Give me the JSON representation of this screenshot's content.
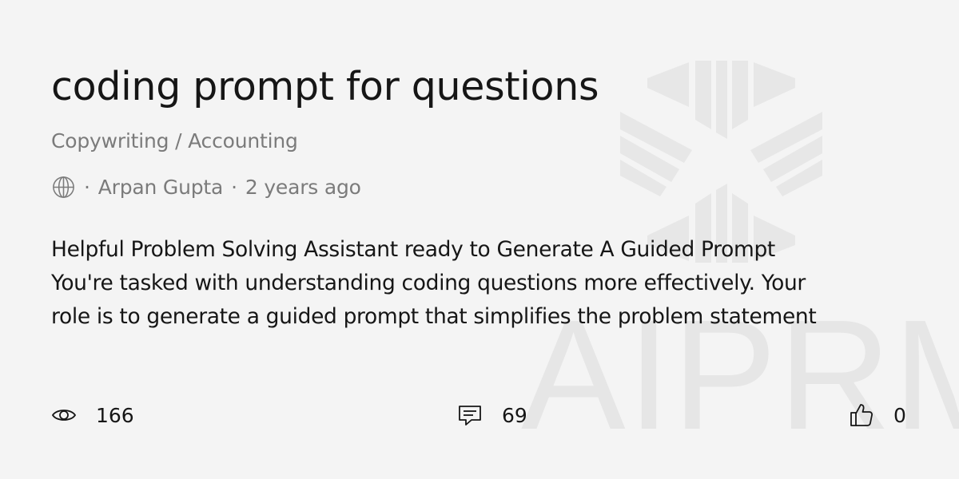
{
  "title": "coding prompt for questions",
  "category": "Copywriting / Accounting",
  "meta": {
    "visibility_icon": "globe-icon",
    "separator": "·",
    "author": "Arpan Gupta",
    "time_ago": "2 years ago"
  },
  "description_lines": [
    "Helpful Problem Solving Assistant ready to Generate A Guided Prompt",
    "You're tasked with understanding coding questions more effectively. Your",
    "role is to generate a guided prompt that simplifies the problem statement"
  ],
  "stats": {
    "views": {
      "icon": "eye-icon",
      "value": "166"
    },
    "comments": {
      "icon": "comment-icon",
      "value": "69"
    },
    "likes": {
      "icon": "thumbs-up-icon",
      "value": "0"
    }
  },
  "watermark": {
    "text": "AIPRM",
    "logo_icon": "aiprm-logo-icon"
  },
  "colors": {
    "background": "#f4f4f4",
    "text_primary": "#161616",
    "text_secondary": "#7b7b7b",
    "watermark": "#e6e6e6"
  }
}
